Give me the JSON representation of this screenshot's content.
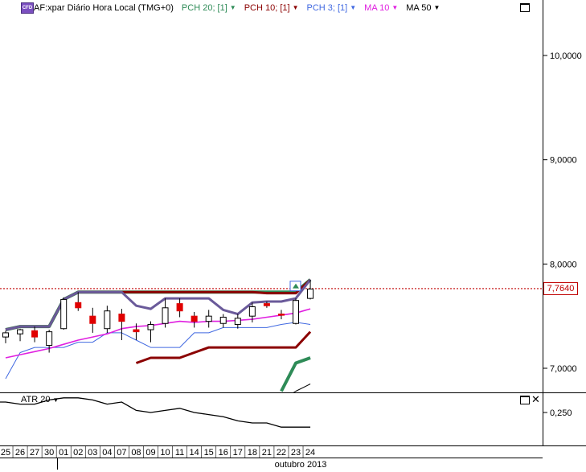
{
  "header": {
    "cfd_badge": "CFD",
    "title": "AF:xpar Diário Hora Local (TMG+0)",
    "indicators": [
      {
        "label": "PCH 20; [1]",
        "color": "#2e8b57"
      },
      {
        "label": "PCH 10; [1]",
        "color": "#8b0000"
      },
      {
        "label": "PCH 3; [1]",
        "color": "#4169e1"
      },
      {
        "label": "MA 10",
        "color": "#e020e0"
      },
      {
        "label": "MA 50",
        "color": "#000000"
      }
    ]
  },
  "price_axis": {
    "labels": [
      "10,0000",
      "9,0000",
      "8,0000",
      "7,0000"
    ],
    "values": [
      10.0,
      9.0,
      8.0,
      7.0
    ]
  },
  "current_price": {
    "label": "7,7640",
    "value": 7.764
  },
  "atr_panel": {
    "label": "ATR 20",
    "axis_label": "0,250"
  },
  "x_axis": {
    "dates": [
      "25",
      "26",
      "27",
      "30",
      "01",
      "02",
      "03",
      "04",
      "07",
      "08",
      "09",
      "10",
      "11",
      "14",
      "15",
      "16",
      "17",
      "18",
      "21",
      "22",
      "23",
      "24"
    ],
    "month_label": "outubro 2013"
  },
  "colors": {
    "ma10": "#e020e0",
    "pch20": "#2e8b57",
    "pch10": "#8b0000",
    "pch3": "#4169e1",
    "price_line": "#c00000",
    "candle_down": "#e00000"
  },
  "chart_data": {
    "type": "candlestick",
    "x": [
      "25",
      "26",
      "27",
      "30",
      "01",
      "02",
      "03",
      "04",
      "07",
      "08",
      "09",
      "10",
      "11",
      "14",
      "15",
      "16",
      "17",
      "18",
      "21",
      "22",
      "23",
      "24"
    ],
    "candles": [
      {
        "o": 7.3,
        "h": 7.36,
        "l": 7.24,
        "c": 7.34
      },
      {
        "o": 7.33,
        "h": 7.38,
        "l": 7.26,
        "c": 7.37
      },
      {
        "o": 7.36,
        "h": 7.4,
        "l": 7.25,
        "c": 7.3
      },
      {
        "o": 7.22,
        "h": 7.37,
        "l": 7.15,
        "c": 7.35
      },
      {
        "o": 7.38,
        "h": 7.68,
        "l": 7.37,
        "c": 7.66
      },
      {
        "o": 7.63,
        "h": 7.73,
        "l": 7.55,
        "c": 7.58
      },
      {
        "o": 7.5,
        "h": 7.58,
        "l": 7.34,
        "c": 7.43
      },
      {
        "o": 7.38,
        "h": 7.6,
        "l": 7.34,
        "c": 7.55
      },
      {
        "o": 7.52,
        "h": 7.57,
        "l": 7.27,
        "c": 7.45
      },
      {
        "o": 7.37,
        "h": 7.43,
        "l": 7.27,
        "c": 7.35
      },
      {
        "o": 7.37,
        "h": 7.45,
        "l": 7.25,
        "c": 7.42
      },
      {
        "o": 7.43,
        "h": 7.67,
        "l": 7.39,
        "c": 7.58
      },
      {
        "o": 7.62,
        "h": 7.67,
        "l": 7.49,
        "c": 7.55
      },
      {
        "o": 7.5,
        "h": 7.54,
        "l": 7.39,
        "c": 7.45
      },
      {
        "o": 7.45,
        "h": 7.56,
        "l": 7.39,
        "c": 7.5
      },
      {
        "o": 7.43,
        "h": 7.52,
        "l": 7.39,
        "c": 7.49
      },
      {
        "o": 7.42,
        "h": 7.52,
        "l": 7.38,
        "c": 7.48
      },
      {
        "o": 7.5,
        "h": 7.63,
        "l": 7.44,
        "c": 7.59
      },
      {
        "o": 7.62,
        "h": 7.64,
        "l": 7.58,
        "c": 7.6
      },
      {
        "o": 7.52,
        "h": 7.56,
        "l": 7.47,
        "c": 7.51
      },
      {
        "o": 7.43,
        "h": 7.67,
        "l": 7.42,
        "c": 7.65
      },
      {
        "o": 7.67,
        "h": 7.85,
        "l": 7.66,
        "c": 7.76
      }
    ],
    "series": [
      {
        "name": "PCH 20; [1]",
        "upper": [
          7.37,
          7.4,
          7.4,
          7.4,
          7.66,
          7.73,
          7.73,
          7.73,
          7.73,
          7.73,
          7.73,
          7.73,
          7.73,
          7.73,
          7.73,
          7.73,
          7.73,
          7.73,
          7.73,
          7.73,
          7.73,
          7.85
        ],
        "lower": [
          null,
          null,
          null,
          null,
          null,
          null,
          null,
          null,
          null,
          null,
          null,
          null,
          null,
          null,
          null,
          null,
          null,
          null,
          null,
          6.78,
          7.05,
          7.1
        ]
      },
      {
        "name": "PCH 10; [1]",
        "upper": [
          7.37,
          7.4,
          7.4,
          7.4,
          7.66,
          7.73,
          7.73,
          7.73,
          7.73,
          7.73,
          7.73,
          7.73,
          7.73,
          7.73,
          7.73,
          7.73,
          7.73,
          7.73,
          7.72,
          7.72,
          7.72,
          7.85
        ],
        "lower": [
          null,
          null,
          null,
          null,
          null,
          null,
          null,
          null,
          null,
          7.05,
          7.1,
          7.1,
          7.1,
          7.15,
          7.2,
          7.2,
          7.2,
          7.2,
          7.2,
          7.2,
          7.2,
          7.35
        ]
      },
      {
        "name": "PCH 3; [1]",
        "upper": [
          7.37,
          7.4,
          7.4,
          7.4,
          7.66,
          7.73,
          7.73,
          7.73,
          7.73,
          7.6,
          7.57,
          7.67,
          7.67,
          7.67,
          7.67,
          7.56,
          7.52,
          7.63,
          7.64,
          7.64,
          7.67,
          7.85
        ],
        "lower": [
          6.9,
          7.15,
          7.2,
          7.2,
          7.2,
          7.25,
          7.25,
          7.34,
          7.34,
          7.27,
          7.2,
          7.2,
          7.2,
          7.34,
          7.34,
          7.39,
          7.39,
          7.39,
          7.39,
          7.42,
          7.44,
          7.42
        ]
      },
      {
        "name": "MA 10",
        "values": [
          7.1,
          7.13,
          7.16,
          7.19,
          7.23,
          7.27,
          7.3,
          7.33,
          7.38,
          7.4,
          7.41,
          7.43,
          7.45,
          7.44,
          7.45,
          7.45,
          7.46,
          7.47,
          7.49,
          7.51,
          7.53,
          7.57
        ]
      },
      {
        "name": "MA 50",
        "values": [
          null,
          null,
          null,
          null,
          null,
          null,
          null,
          null,
          null,
          null,
          null,
          null,
          null,
          null,
          null,
          null,
          null,
          6.6,
          6.63,
          6.69,
          6.78,
          6.85
        ]
      }
    ],
    "atr": [
      0.3,
      0.29,
      0.29,
      0.31,
      0.32,
      0.32,
      0.31,
      0.29,
      0.3,
      0.26,
      0.25,
      0.26,
      0.27,
      0.25,
      0.24,
      0.23,
      0.21,
      0.2,
      0.2,
      0.18,
      0.18,
      0.18
    ],
    "ylim": [
      6.76,
      10.5
    ],
    "atr_ylim": [
      0.15,
      0.36
    ],
    "grid": false
  }
}
